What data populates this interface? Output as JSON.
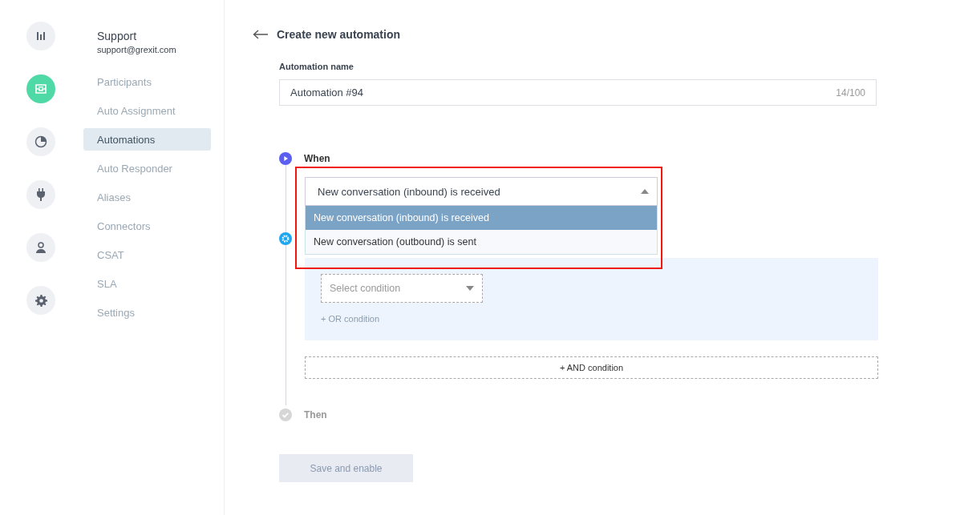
{
  "nav_rail": [
    {
      "kind": "bars",
      "selected": false
    },
    {
      "kind": "inbox",
      "selected": true
    },
    {
      "kind": "pie",
      "selected": false
    },
    {
      "kind": "plug",
      "selected": false
    },
    {
      "kind": "person",
      "selected": false
    },
    {
      "kind": "gear",
      "selected": false
    }
  ],
  "account": {
    "name": "Support",
    "email": "support@grexit.com"
  },
  "menu": [
    {
      "label": "Participants",
      "selected": false
    },
    {
      "label": "Auto Assignment",
      "selected": false
    },
    {
      "label": "Automations",
      "selected": true
    },
    {
      "label": "Auto Responder",
      "selected": false
    },
    {
      "label": "Aliases",
      "selected": false
    },
    {
      "label": "Connectors",
      "selected": false
    },
    {
      "label": "CSAT",
      "selected": false
    },
    {
      "label": "SLA",
      "selected": false
    },
    {
      "label": "Settings",
      "selected": false
    }
  ],
  "header": {
    "title": "Create new automation"
  },
  "name_field": {
    "label": "Automation name",
    "value": "Automation #94",
    "counter": "14/100"
  },
  "steps": [
    {
      "kind": "trigger",
      "label": "When",
      "select": {
        "value": "New conversation (inbound) is received",
        "expanded": true,
        "options": [
          {
            "label": "New conversation (inbound) is received",
            "selected": true
          },
          {
            "label": "New conversation (outbound) is sent",
            "selected": false
          }
        ]
      }
    },
    {
      "kind": "conditions",
      "condition_select": {
        "placeholder": "Select condition"
      },
      "or_link": "+ OR condition",
      "and_button": "+ AND condition"
    },
    {
      "kind": "action",
      "label": "Then"
    }
  ],
  "save_button": {
    "label": "Save and enable",
    "disabled": true
  }
}
